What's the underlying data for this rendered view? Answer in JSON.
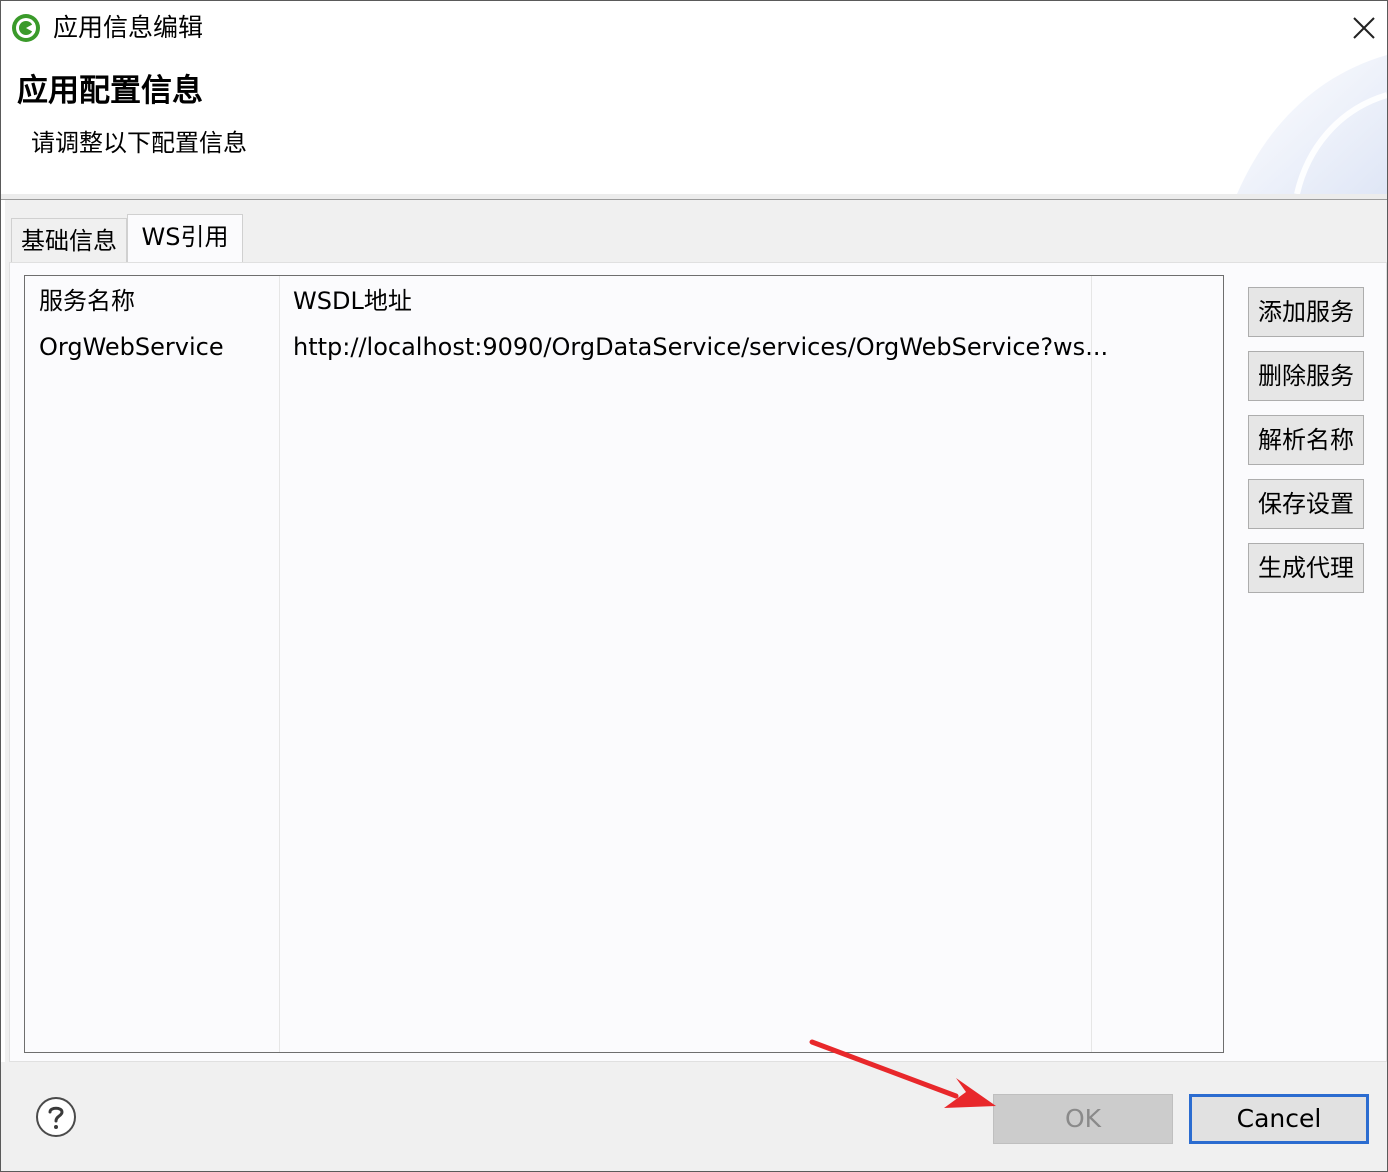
{
  "window": {
    "title": "应用信息编辑"
  },
  "header": {
    "title": "应用配置信息",
    "description": "请调整以下配置信息"
  },
  "tabs": [
    {
      "label": "基础信息",
      "selected": false
    },
    {
      "label": "WS引用",
      "selected": true
    }
  ],
  "table": {
    "columns": [
      "服务名称",
      "WSDL地址"
    ],
    "rows": [
      [
        "OrgWebService",
        "http://localhost:9090/OrgDataService/services/OrgWebService?ws..."
      ]
    ]
  },
  "actions": {
    "add_service": "添加服务",
    "delete_service": "删除服务",
    "parse_name": "解析名称",
    "save_settings": "保存设置",
    "generate_proxy": "生成代理"
  },
  "footer": {
    "ok_label": "OK",
    "cancel_label": "Cancel"
  },
  "icons": {
    "app": "app-logo-icon",
    "close": "close-icon",
    "help": "help-icon",
    "annotation": "red-arrow-annotation"
  },
  "colors": {
    "app_icon_green": "#3a9a2a",
    "accent_blue": "#2b6cd0",
    "annotation_red": "#e8282b",
    "ok_disabled_bg": "#cccccc"
  }
}
